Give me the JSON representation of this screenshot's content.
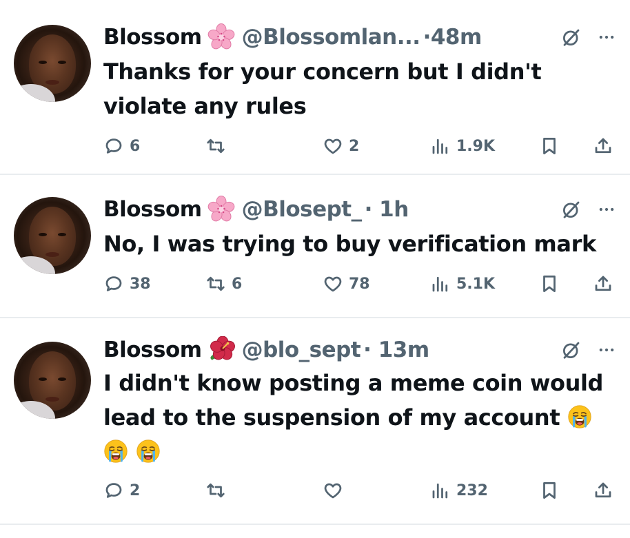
{
  "tweets": [
    {
      "name": "Blossom",
      "flower": "cherry-blossom",
      "handle": "@Blossomlan...",
      "time": "·48m",
      "lines": [
        "Thanks for your concern but I didn't",
        "violate  any rules"
      ],
      "replies": "6",
      "retweets": "",
      "likes": "2",
      "views": "1.9K"
    },
    {
      "name": "Blossom",
      "flower": "cherry-blossom",
      "handle": "@Blosept_",
      "time": "· 1h",
      "lines": [
        "No, I was trying to buy verification mark"
      ],
      "replies": "38",
      "retweets": "6",
      "likes": "78",
      "views": "5.1K"
    },
    {
      "name": "Blossom",
      "flower": "hibiscus",
      "handle": "@blo_sept",
      "time": "· 13m",
      "lines": [
        "I didn't know posting a meme coin would",
        "lead to the suspension of my account"
      ],
      "emoji": "loudly-crying-face",
      "replies": "2",
      "retweets": "",
      "likes": "",
      "views": "232"
    }
  ],
  "colors": {
    "text": "#0f1419",
    "secondary": "#536471",
    "divider": "#e9ecef",
    "cherry_blossom": "#f7a8c8",
    "hibiscus": "#d12a4a"
  },
  "icons": [
    "reply-icon",
    "retweet-icon",
    "like-icon",
    "views-icon",
    "bookmark-icon",
    "share-icon",
    "grok-icon",
    "more-icon",
    "cherry-blossom-icon",
    "hibiscus-icon",
    "loudly-crying-face-icon"
  ]
}
